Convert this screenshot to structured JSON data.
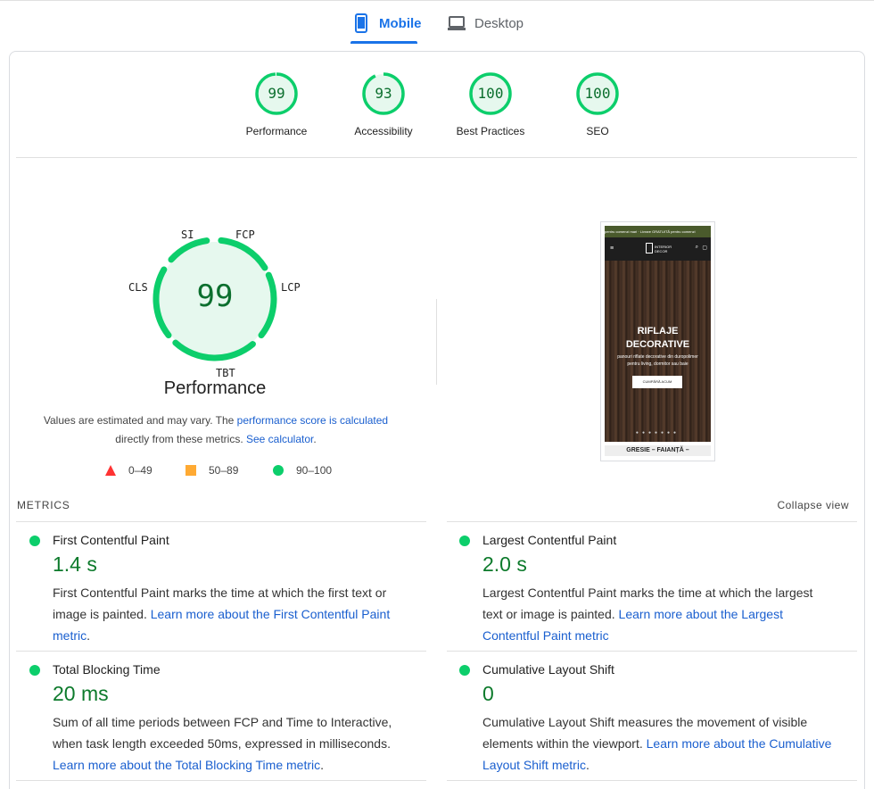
{
  "tabs": {
    "mobile": "Mobile",
    "desktop": "Desktop"
  },
  "scores": [
    {
      "label": "Performance",
      "value": "99"
    },
    {
      "label": "Accessibility",
      "value": "93"
    },
    {
      "label": "Best Practices",
      "value": "100"
    },
    {
      "label": "SEO",
      "value": "100"
    }
  ],
  "performance": {
    "score": "99",
    "title": "Performance",
    "metric_labels": {
      "si": "SI",
      "fcp": "FCP",
      "lcp": "LCP",
      "tbt": "TBT",
      "cls": "CLS"
    },
    "note_pre": "Values are estimated and may vary. The ",
    "note_link": "performance score is calculated",
    "note_mid": " directly from these metrics. ",
    "note_link2": "See calculator",
    "note_post": ".",
    "legend": [
      {
        "shape": "triangle",
        "range": "0–49",
        "color": "#ff3333"
      },
      {
        "shape": "square",
        "range": "50–89",
        "color": "#ffaa33"
      },
      {
        "shape": "circle",
        "range": "90–100",
        "color": "#0cce6b"
      }
    ]
  },
  "screenshot": {
    "promo": "pentru comenzi mari   ·   Livrare GRATUITĂ pentru comenzi",
    "logo_line1": "INTERIOR",
    "logo_line2": "DECOR",
    "hero_title": "RIFLAJE DECORATIVE",
    "hero_sub": "panouri riflate decorative din duropolimer pentru living, dormitor sau baie",
    "hero_button": "CUMPĂRĂ ACUM",
    "footer": "GRESIE – FAIANȚĂ –"
  },
  "metrics": {
    "header": "METRICS",
    "collapse": "Collapse view",
    "items": [
      {
        "name": "First Contentful Paint",
        "value": "1.4 s",
        "desc": "First Contentful Paint marks the time at which the first text or image is painted. ",
        "link": "Learn more about the First Contentful Paint metric",
        "post": "."
      },
      {
        "name": "Largest Contentful Paint",
        "value": "2.0 s",
        "desc": "Largest Contentful Paint marks the time at which the largest text or image is painted. ",
        "link": "Learn more about the Largest Contentful Paint metric",
        "post": ""
      },
      {
        "name": "Total Blocking Time",
        "value": "20 ms",
        "desc": "Sum of all time periods between FCP and Time to Interactive, when task length exceeded 50ms, expressed in milliseconds. ",
        "link": "Learn more about the Total Blocking Time metric",
        "post": "."
      },
      {
        "name": "Cumulative Layout Shift",
        "value": "0",
        "desc": "Cumulative Layout Shift measures the movement of visible elements within the viewport. ",
        "link": "Learn more about the Cumulative Layout Shift metric",
        "post": "."
      }
    ]
  },
  "colors": {
    "pass": "#0cce6b",
    "pass_fill": "#e6f8ee",
    "pass_text": "#0c6f2e",
    "accent": "#1a73e8",
    "link": "#1a5fcf"
  }
}
